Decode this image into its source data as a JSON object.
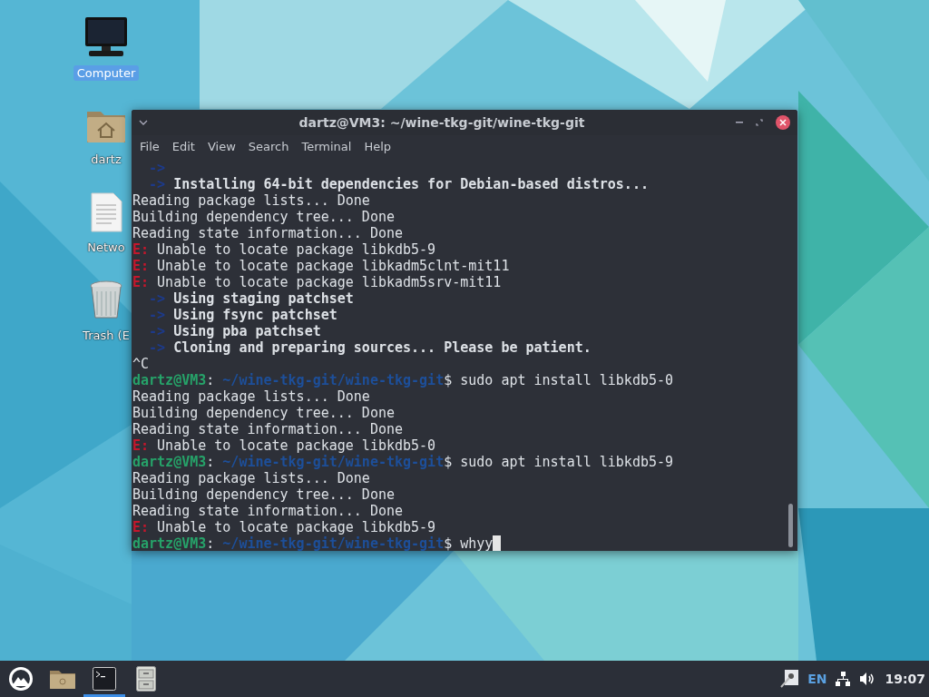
{
  "desktop": {
    "icons": [
      {
        "kind": "computer",
        "label": "Computer",
        "selected": true
      },
      {
        "kind": "home",
        "label": "dartz",
        "selected": false
      },
      {
        "kind": "document",
        "label": "Netwo",
        "selected": false
      },
      {
        "kind": "trash",
        "label": "Trash (E",
        "selected": false
      }
    ]
  },
  "terminal": {
    "title": "dartz@VM3: ~/wine-tkg-git/wine-tkg-git",
    "menu": [
      "File",
      "Edit",
      "View",
      "Search",
      "Terminal",
      "Help"
    ],
    "lines": [
      [
        {
          "kind": "bullet",
          "text": "  ->"
        }
      ],
      [
        {
          "kind": "bullet",
          "text": "  ->"
        },
        {
          "kind": "bold",
          "text": " Installing 64-bit dependencies for Debian-based distros..."
        }
      ],
      [
        {
          "kind": "plain",
          "text": "Reading package lists... Done"
        }
      ],
      [
        {
          "kind": "plain",
          "text": "Building dependency tree... Done"
        }
      ],
      [
        {
          "kind": "plain",
          "text": "Reading state information... Done"
        }
      ],
      [
        {
          "kind": "error",
          "text": "E:"
        },
        {
          "kind": "plain",
          "text": " Unable to locate package libkdb5-9"
        }
      ],
      [
        {
          "kind": "error",
          "text": "E:"
        },
        {
          "kind": "plain",
          "text": " Unable to locate package libkadm5clnt-mit11"
        }
      ],
      [
        {
          "kind": "error",
          "text": "E:"
        },
        {
          "kind": "plain",
          "text": " Unable to locate package libkadm5srv-mit11"
        }
      ],
      [
        {
          "kind": "bullet",
          "text": "  ->"
        },
        {
          "kind": "bold",
          "text": " Using staging patchset"
        }
      ],
      [
        {
          "kind": "bullet",
          "text": "  ->"
        },
        {
          "kind": "bold",
          "text": " Using fsync patchset"
        }
      ],
      [
        {
          "kind": "bullet",
          "text": "  ->"
        },
        {
          "kind": "bold",
          "text": " Using pba patchset"
        }
      ],
      [
        {
          "kind": "bullet",
          "text": "  ->"
        },
        {
          "kind": "bold",
          "text": " Cloning and preparing sources... Please be patient."
        }
      ],
      [
        {
          "kind": "plain",
          "text": "^C"
        }
      ],
      [
        {
          "kind": "user",
          "text": "dartz@VM3"
        },
        {
          "kind": "plain",
          "text": ": "
        },
        {
          "kind": "path",
          "text": "~/wine-tkg-git/wine-tkg-git"
        },
        {
          "kind": "plain",
          "text": "$ sudo apt install libkdb5-0"
        }
      ],
      [
        {
          "kind": "plain",
          "text": "Reading package lists... Done"
        }
      ],
      [
        {
          "kind": "plain",
          "text": "Building dependency tree... Done"
        }
      ],
      [
        {
          "kind": "plain",
          "text": "Reading state information... Done"
        }
      ],
      [
        {
          "kind": "error",
          "text": "E:"
        },
        {
          "kind": "plain",
          "text": " Unable to locate package libkdb5-0"
        }
      ],
      [
        {
          "kind": "user",
          "text": "dartz@VM3"
        },
        {
          "kind": "plain",
          "text": ": "
        },
        {
          "kind": "path",
          "text": "~/wine-tkg-git/wine-tkg-git"
        },
        {
          "kind": "plain",
          "text": "$ sudo apt install libkdb5-9"
        }
      ],
      [
        {
          "kind": "plain",
          "text": "Reading package lists... Done"
        }
      ],
      [
        {
          "kind": "plain",
          "text": "Building dependency tree... Done"
        }
      ],
      [
        {
          "kind": "plain",
          "text": "Reading state information... Done"
        }
      ],
      [
        {
          "kind": "error",
          "text": "E:"
        },
        {
          "kind": "plain",
          "text": " Unable to locate package libkdb5-9"
        }
      ],
      [
        {
          "kind": "user",
          "text": "dartz@VM3"
        },
        {
          "kind": "plain",
          "text": ": "
        },
        {
          "kind": "path",
          "text": "~/wine-tkg-git/wine-tkg-git"
        },
        {
          "kind": "plain",
          "text": "$ whyy"
        },
        {
          "kind": "cursor"
        }
      ]
    ]
  },
  "taskbar": {
    "apps": [
      {
        "kind": "logo",
        "active": false
      },
      {
        "kind": "folder",
        "active": false
      },
      {
        "kind": "terminal",
        "active": true
      },
      {
        "kind": "cabinet",
        "active": false
      }
    ],
    "tray": {
      "keyboard_layout": "EN",
      "clock": "19:07"
    }
  }
}
